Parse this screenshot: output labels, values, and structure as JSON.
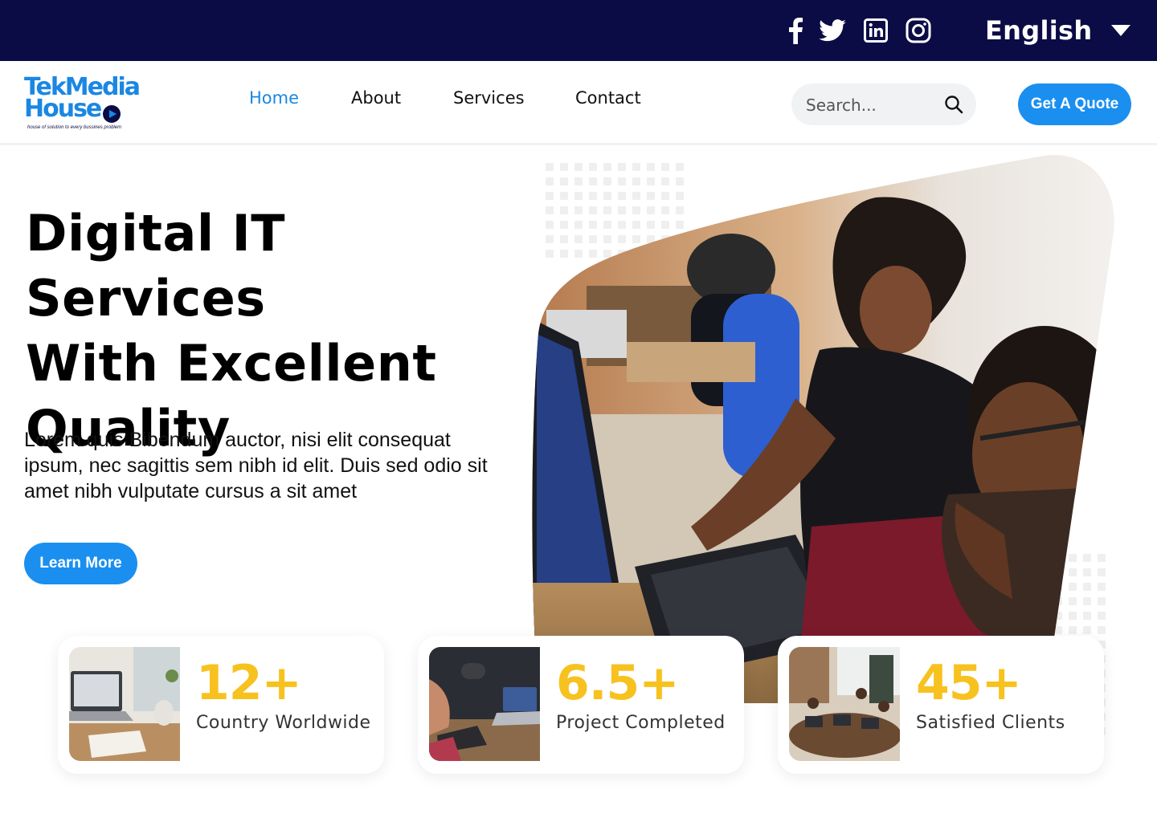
{
  "topbar": {
    "social": [
      "facebook-icon",
      "twitter-icon",
      "linkedin-icon",
      "instagram-icon"
    ],
    "language": "English"
  },
  "header": {
    "logo": {
      "line1": "TekMedia",
      "line2": "House",
      "tagline": "house of solution to every bussines problem"
    },
    "nav": [
      {
        "label": "Home",
        "active": true
      },
      {
        "label": "About",
        "active": false
      },
      {
        "label": "Services",
        "active": false
      },
      {
        "label": "Contact",
        "active": false
      }
    ],
    "search": {
      "placeholder": "Search...",
      "value": ""
    },
    "quote_label": "Get A Quote"
  },
  "hero": {
    "title_lines": [
      "Digital IT Services",
      "With Excellent",
      "Quality"
    ],
    "description": "Lorem quis Bibendum auctor, nisi elit consequat ipsum, nec sagittis sem nibh id elit. Duis sed odio sit amet nibh vulputate cursus a sit amet",
    "cta_label": "Learn More"
  },
  "stats": [
    {
      "value": "12+",
      "label": "Country Worldwide"
    },
    {
      "value": "6.5+",
      "label": "Project Completed"
    },
    {
      "value": "45+",
      "label": "Satisfied Clients"
    }
  ],
  "colors": {
    "topbar": "#0b0c45",
    "accent": "#1a8ff0",
    "stat_value": "#f7c21f"
  }
}
